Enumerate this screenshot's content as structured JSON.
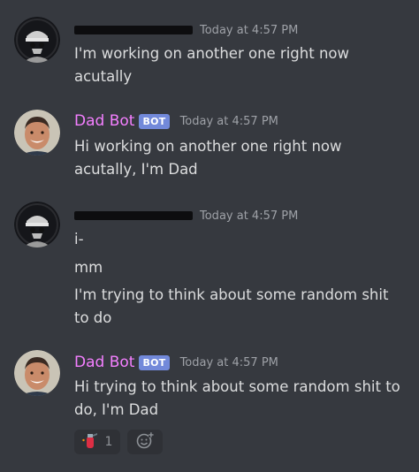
{
  "messages": [
    {
      "author": "",
      "author_redacted": true,
      "timestamp": "Today at 4:57 PM",
      "lines": [
        "I'm working on another one right now",
        "acutally"
      ]
    },
    {
      "author": "Dad Bot",
      "badge": "BOT",
      "timestamp": "Today at 4:57 PM",
      "lines": [
        "Hi working on another one right now",
        "acutally, I'm Dad"
      ]
    },
    {
      "author": "",
      "author_redacted": true,
      "timestamp": "Today at 4:57 PM",
      "lines": [
        "i-",
        "mm",
        "I'm trying to think about some random shit",
        "to do"
      ]
    },
    {
      "author": "Dad Bot",
      "badge": "BOT",
      "timestamp": "Today at 4:57 PM",
      "lines": [
        "Hi trying to think about some random shit to",
        "do, I'm Dad"
      ],
      "reactions": [
        {
          "icon": "fire-extinguisher-icon",
          "count": "1"
        }
      ]
    }
  ],
  "add_reaction_icon": "add-reaction-smiley-icon",
  "colors": {
    "background": "#36393f",
    "bot_username": "#f47fff",
    "bot_badge": "#7289da",
    "message_text": "#dcddde",
    "timestamp": "#9ea1a7"
  }
}
